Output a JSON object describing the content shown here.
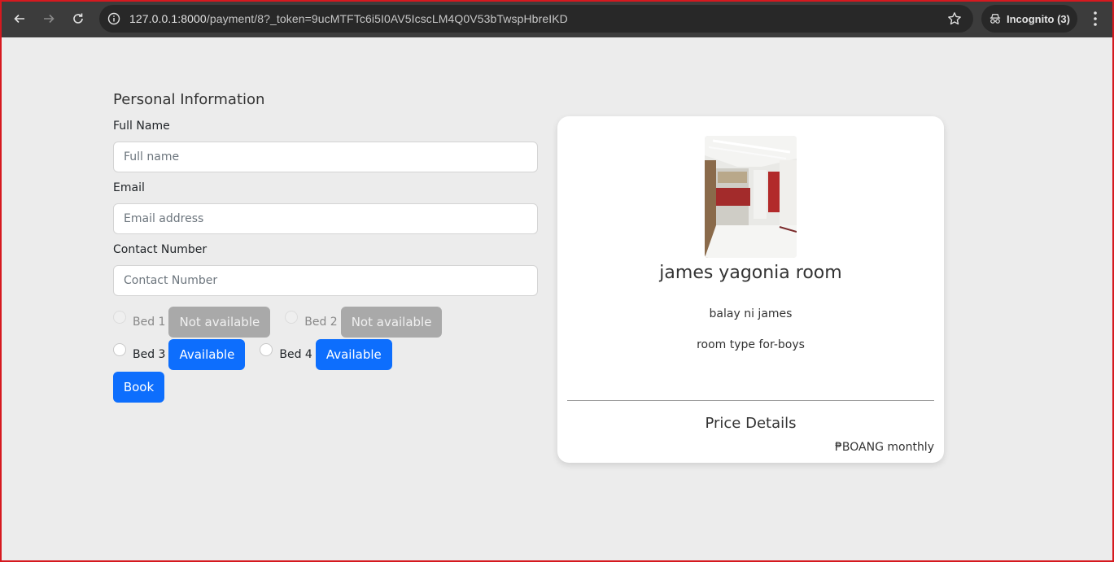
{
  "browser": {
    "url_host": "127.0.0.1:8000",
    "url_path": "/payment/8?_token=9ucMTFTc6i5I0AV5IcscLM4Q0V53bTwspHbreIKD",
    "incognito_label": "Incognito (3)"
  },
  "form": {
    "section_title": "Personal Information",
    "full_name": {
      "label": "Full Name",
      "placeholder": "Full name",
      "value": ""
    },
    "email": {
      "label": "Email",
      "placeholder": "Email address",
      "value": ""
    },
    "contact": {
      "label": "Contact Number",
      "placeholder": "Contact Number",
      "value": ""
    },
    "beds": [
      {
        "label": "Bed 1",
        "status": "Not available",
        "available": false
      },
      {
        "label": "Bed 2",
        "status": "Not available",
        "available": false
      },
      {
        "label": "Bed 3",
        "status": "Available",
        "available": true
      },
      {
        "label": "Bed 4",
        "status": "Available",
        "available": true
      }
    ],
    "book_label": "Book"
  },
  "room_card": {
    "name": "james yagonia room",
    "description": "balay ni james",
    "room_type": "room type for-boys",
    "price_title": "Price Details",
    "price_value": "₱BOANG monthly"
  },
  "colors": {
    "primary": "#0d6efd",
    "disabled": "#a9a9a9",
    "page_bg": "#ececec"
  }
}
